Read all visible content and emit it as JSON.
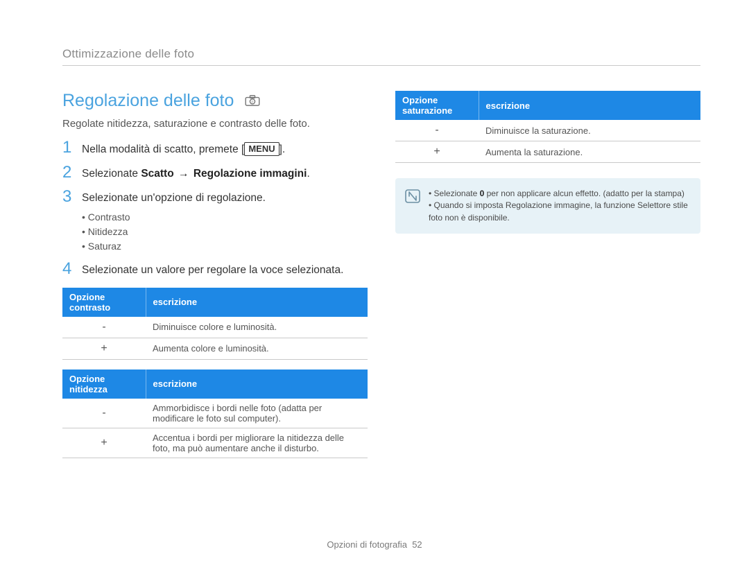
{
  "breadcrumb": "Ottimizzazione delle foto",
  "section_title": "Regolazione delle foto",
  "subtitle": "Regolate nitidezza, saturazione e contrasto delle foto.",
  "steps": {
    "s1": {
      "num": "1",
      "pre": "Nella modalità di scatto, premete [",
      "key": "MENU",
      "post": "]."
    },
    "s2": {
      "num": "2",
      "pre": "Selezionate ",
      "b1": "Scatto",
      "arrow": "→",
      "b2": "Regolazione immagini",
      "post": "."
    },
    "s3": {
      "num": "3",
      "text": "Selezionate un'opzione di regolazione.",
      "bullets": [
        "Contrasto",
        "Nitidezza",
        "Saturaz"
      ]
    },
    "s4": {
      "num": "4",
      "text": "Selezionate un valore per regolare la voce selezionata."
    }
  },
  "tables": {
    "contrast": {
      "h1": "Opzione contrasto",
      "h2": "escrizione",
      "rows": [
        {
          "opt": "-",
          "desc": "Diminuisce colore e luminosità."
        },
        {
          "opt": "+",
          "desc": "Aumenta colore e luminosità."
        }
      ]
    },
    "sharpness": {
      "h1": "Opzione nitidezza",
      "h2": "escrizione",
      "rows": [
        {
          "opt": "-",
          "desc": "Ammorbidisce i bordi nelle foto (adatta per modificare le foto sul computer)."
        },
        {
          "opt": "+",
          "desc": "Accentua i bordi per migliorare la nitidezza delle foto, ma può aumentare anche il disturbo."
        }
      ]
    },
    "saturation": {
      "h1": "Opzione saturazione",
      "h2": "escrizione",
      "rows": [
        {
          "opt": "-",
          "desc": "Diminuisce la saturazione."
        },
        {
          "opt": "+",
          "desc": "Aumenta la saturazione."
        }
      ]
    }
  },
  "notes": {
    "n1_pre": "Selezionate ",
    "n1_bold": "0",
    "n1_post": " per non applicare alcun effetto. (adatto per la stampa)",
    "n2": "Quando si imposta Regolazione immagine, la funzione Selettore stile foto non è disponibile."
  },
  "footer": {
    "label": "Opzioni di fotografia",
    "page": "52"
  }
}
